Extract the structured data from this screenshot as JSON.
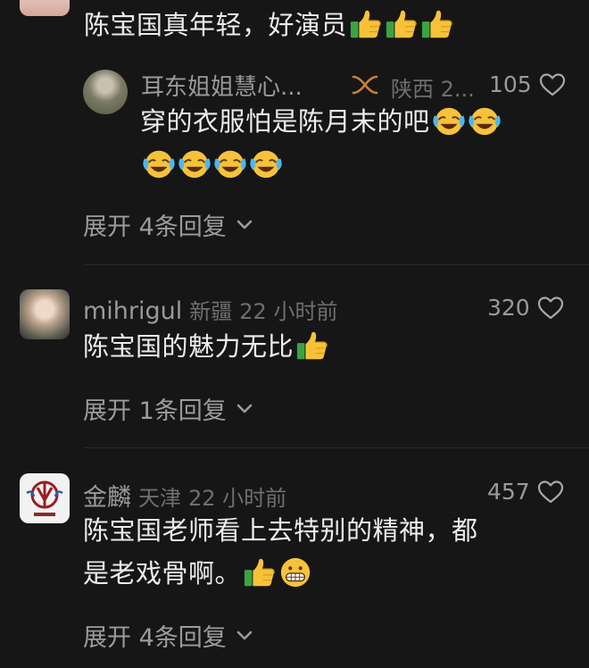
{
  "comments": [
    {
      "text_line1": "陈宝国真年轻，好演员",
      "reply": {
        "name": "耳东姐姐慧心...",
        "location": "陕西 2...",
        "likes": "105",
        "text_line1": "穿的衣服怕是陈月末的吧"
      },
      "expand_label": "展开 4条回复"
    },
    {
      "name": "mihrigul",
      "location": "新疆",
      "time": "22 小时前",
      "likes": "320",
      "text_line1": "陈宝国的魅力无比",
      "expand_label": "展开 1条回复"
    },
    {
      "name": "金麟",
      "location": "天津",
      "time": "22 小时前",
      "likes": "457",
      "text_line1": "陈宝国老师看上去特别的精神，都",
      "text_line2": "是老戏骨啊。",
      "expand_label": "展开 4条回复"
    }
  ],
  "icons": {
    "heart": "heart-outline-icon",
    "chevron": "chevron-down-icon",
    "thumbs_up": "thumbs-up-emoji",
    "crying_laugh": "laughing-crying-emoji",
    "grin": "grinning-emoji",
    "badge": "infinity-badge-icon"
  },
  "colors": {
    "background": "#161616",
    "primary_text": "#ececec",
    "secondary_text": "#8b8b8b"
  }
}
